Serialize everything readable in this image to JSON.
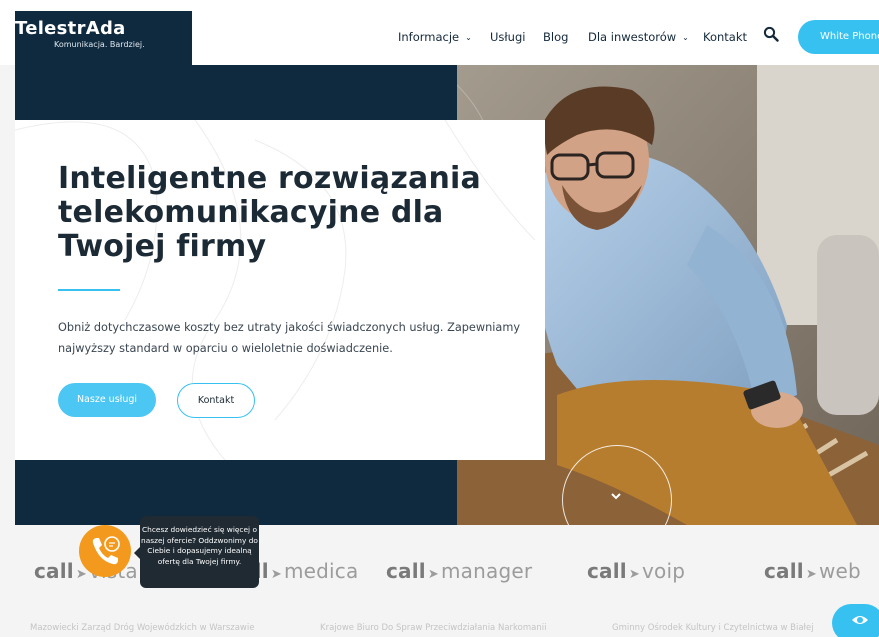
{
  "header": {
    "logo_title": "TelestrAda",
    "logo_tagline": "Komunikacja. Bardziej.",
    "nav": [
      {
        "label": "Informacje",
        "has_dropdown": true
      },
      {
        "label": "Usługi",
        "has_dropdown": false
      },
      {
        "label": "Blog",
        "has_dropdown": false
      },
      {
        "label": "Dla inwestorów",
        "has_dropdown": true
      },
      {
        "label": "Kontakt",
        "has_dropdown": false
      }
    ],
    "cta_label": "White Phone",
    "search_icon": "search-icon"
  },
  "hero": {
    "title": "Inteligentne rozwiązania telekomunikacyjne dla Twojej firmy",
    "text": "Obniż dotychczasowe koszty bez utraty jakości świadczonych usług. Zapewniamy najwyższy standard w oparciu o wieloletnie doświadczenie.",
    "primary_button": "Nasze usługi",
    "secondary_button": "Kontakt",
    "scroll_icon": "chevron-down-icon"
  },
  "partners": {
    "brands": [
      {
        "prefix": "call",
        "name": "vista"
      },
      {
        "prefix": "call",
        "name": "medica"
      },
      {
        "prefix": "call",
        "name": "manager"
      },
      {
        "prefix": "call",
        "name": "voip"
      },
      {
        "prefix": "call",
        "name": "web"
      }
    ],
    "clients": [
      "Mazowiecki Zarząd Dróg Wojewódzkich w Warszawie",
      "Krajowe Biuro Do Spraw Przeciwdziałania Narkomanii",
      "Gminny Ośrodek Kultury i Czytelnictwa w Białej"
    ]
  },
  "chat": {
    "tooltip": "Chcesz dowiedzieć się więcej o naszej ofercie? Oddzwonimy do Ciebie i dopasujemy idealną ofertę dla Twojej firmy.",
    "icon": "phone-chat-icon"
  },
  "accessibility": {
    "icon": "eye-icon"
  },
  "colors": {
    "navy": "#0f2a3f",
    "accent": "#37c1f1",
    "chat_orange": "#f39a1e",
    "tooltip_bg": "#1f2a33",
    "partners_bg": "#f4f4f4"
  }
}
